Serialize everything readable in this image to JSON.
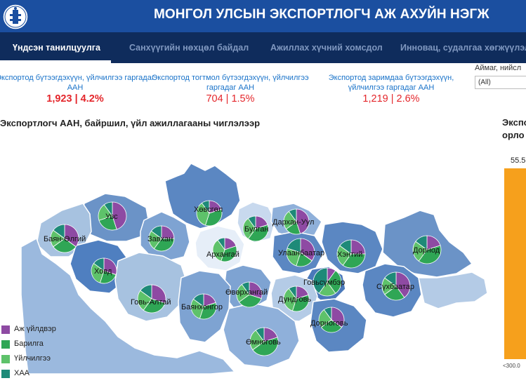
{
  "header": {
    "title": "МОНГОЛ УЛСЫН ЭКСПОРТЛОГЧ АЖ АХУЙН НЭГЖ",
    "emblem_icon": "soyombo-emblem-icon",
    "bg_color": "#1b4fa0"
  },
  "nav": {
    "tabs": [
      {
        "label": "Үндсэн танилцуулга",
        "active": true
      },
      {
        "label": "Санхүүгийн нөхцөл байдал",
        "active": false
      },
      {
        "label": "Ажиллах хүчний хомсдол",
        "active": false
      },
      {
        "label": "Инновац, судалгаа хөгжүүлэлт",
        "active": false
      }
    ]
  },
  "stats": [
    {
      "label": "Экспортод бүтээгдэхүүн, үйлчилгээ гаргадаг ААН",
      "value": "1,923 | 4.2%",
      "color": "#e4262b",
      "bold": true
    },
    {
      "label": "Экспортод тогтмол бүтээгдэхүүн, үйлчилгээ гаргадаг ААН",
      "value": "704 | 1.5%",
      "color": "#e4262b",
      "bold": false
    },
    {
      "label": "Экспортод заримдаа бүтээгдэхүүн, үйлчилгээ гаргадаг ААН",
      "value": "1,219 | 2.6%",
      "color": "#e4262b",
      "bold": false
    }
  ],
  "filter": {
    "label": "Аймаг, нийсл",
    "selected": "(All)"
  },
  "map_section": {
    "title": "Экспортлогч ААН, байршил, үйл ажиллагааны чиглэлээр"
  },
  "right_panel": {
    "title_line1": "Экспо",
    "title_line2": "орло",
    "bar_value": "55.5",
    "axis_label": "<300.0",
    "bar_color": "#f6a01c"
  },
  "legend": [
    {
      "label": "Аж үйлдвэр",
      "color": "#8e4aa3"
    },
    {
      "label": "Барилга",
      "color": "#2fa655"
    },
    {
      "label": "Үйлчилгээ",
      "color": "#5ec26a"
    },
    {
      "label": "ХАА",
      "color": "#1e8a78"
    }
  ],
  "provinces": [
    {
      "name": "Увс",
      "shares": [
        45,
        25,
        20,
        10
      ]
    },
    {
      "name": "Хөвсгөл",
      "shares": [
        20,
        35,
        35,
        10
      ]
    },
    {
      "name": "Баян-Өлгий",
      "shares": [
        35,
        30,
        20,
        15
      ]
    },
    {
      "name": "Завхан",
      "shares": [
        25,
        35,
        25,
        15
      ]
    },
    {
      "name": "Булган",
      "shares": [
        20,
        40,
        30,
        10
      ]
    },
    {
      "name": "Дархан-Уул",
      "shares": [
        45,
        20,
        25,
        10
      ]
    },
    {
      "name": "Ховд",
      "shares": [
        30,
        25,
        30,
        15
      ]
    },
    {
      "name": "Архангай",
      "shares": [
        20,
        35,
        35,
        10
      ]
    },
    {
      "name": "Улаанбаатар",
      "shares": [
        35,
        20,
        25,
        20
      ]
    },
    {
      "name": "Хэнтий",
      "shares": [
        25,
        35,
        25,
        15
      ]
    },
    {
      "name": "Дорнод",
      "shares": [
        20,
        40,
        25,
        15
      ]
    },
    {
      "name": "Говьсүмбэр",
      "shares": [
        10,
        30,
        20,
        40
      ]
    },
    {
      "name": "Өвөрхангай",
      "shares": [
        30,
        35,
        25,
        10
      ]
    },
    {
      "name": "Сүхбаатар",
      "shares": [
        40,
        25,
        20,
        15
      ]
    },
    {
      "name": "Говь-Алтай",
      "shares": [
        30,
        30,
        25,
        15
      ]
    },
    {
      "name": "Дундговь",
      "shares": [
        20,
        35,
        35,
        10
      ]
    },
    {
      "name": "Баянхонгор",
      "shares": [
        20,
        35,
        30,
        15
      ]
    },
    {
      "name": "Дорноговь",
      "shares": [
        35,
        30,
        25,
        10
      ]
    },
    {
      "name": "Өмнөговь",
      "shares": [
        20,
        45,
        25,
        10
      ]
    }
  ]
}
